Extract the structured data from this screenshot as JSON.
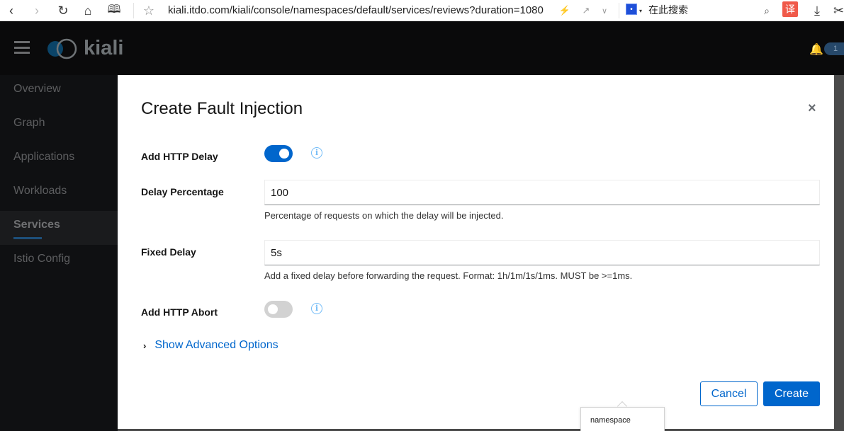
{
  "browser": {
    "url": "kiali.itdo.com/kiali/console/namespaces/default/services/reviews?duration=1080",
    "search_placeholder": "在此搜索",
    "translate_label": "译",
    "icons": [
      "back-icon",
      "forward-icon",
      "reload-icon",
      "home-icon",
      "reading-icon",
      "star-icon",
      "bolt-icon",
      "share-icon",
      "chevron-down-icon",
      "baidu-icon",
      "search-icon",
      "translate-icon",
      "download-icon",
      "scissors-icon"
    ]
  },
  "app": {
    "logo_text": "kiali",
    "notification_count": "1"
  },
  "sidebar": {
    "items": [
      {
        "label": "Overview",
        "active": false
      },
      {
        "label": "Graph",
        "active": false
      },
      {
        "label": "Applications",
        "active": false
      },
      {
        "label": "Workloads",
        "active": false
      },
      {
        "label": "Services",
        "active": true
      },
      {
        "label": "Istio Config",
        "active": false
      }
    ]
  },
  "modal": {
    "title": "Create Fault Injection",
    "close_label": "×",
    "http_delay": {
      "label": "Add HTTP Delay",
      "enabled": true
    },
    "delay_percentage": {
      "label": "Delay Percentage",
      "value": "100",
      "helper": "Percentage of requests on which the delay will be injected."
    },
    "fixed_delay": {
      "label": "Fixed Delay",
      "value": "5s",
      "helper": "Add a fixed delay before forwarding the request. Format: 1h/1m/1s/1ms. MUST be >=1ms."
    },
    "http_abort": {
      "label": "Add HTTP Abort",
      "enabled": false
    },
    "advanced_label": "Show Advanced Options",
    "cancel_label": "Cancel",
    "create_label": "Create"
  },
  "tooltip": {
    "text": "namespace"
  },
  "colors": {
    "primary": "#0066cc",
    "info": "#73bcf7",
    "masthead": "#0a0a0b"
  }
}
